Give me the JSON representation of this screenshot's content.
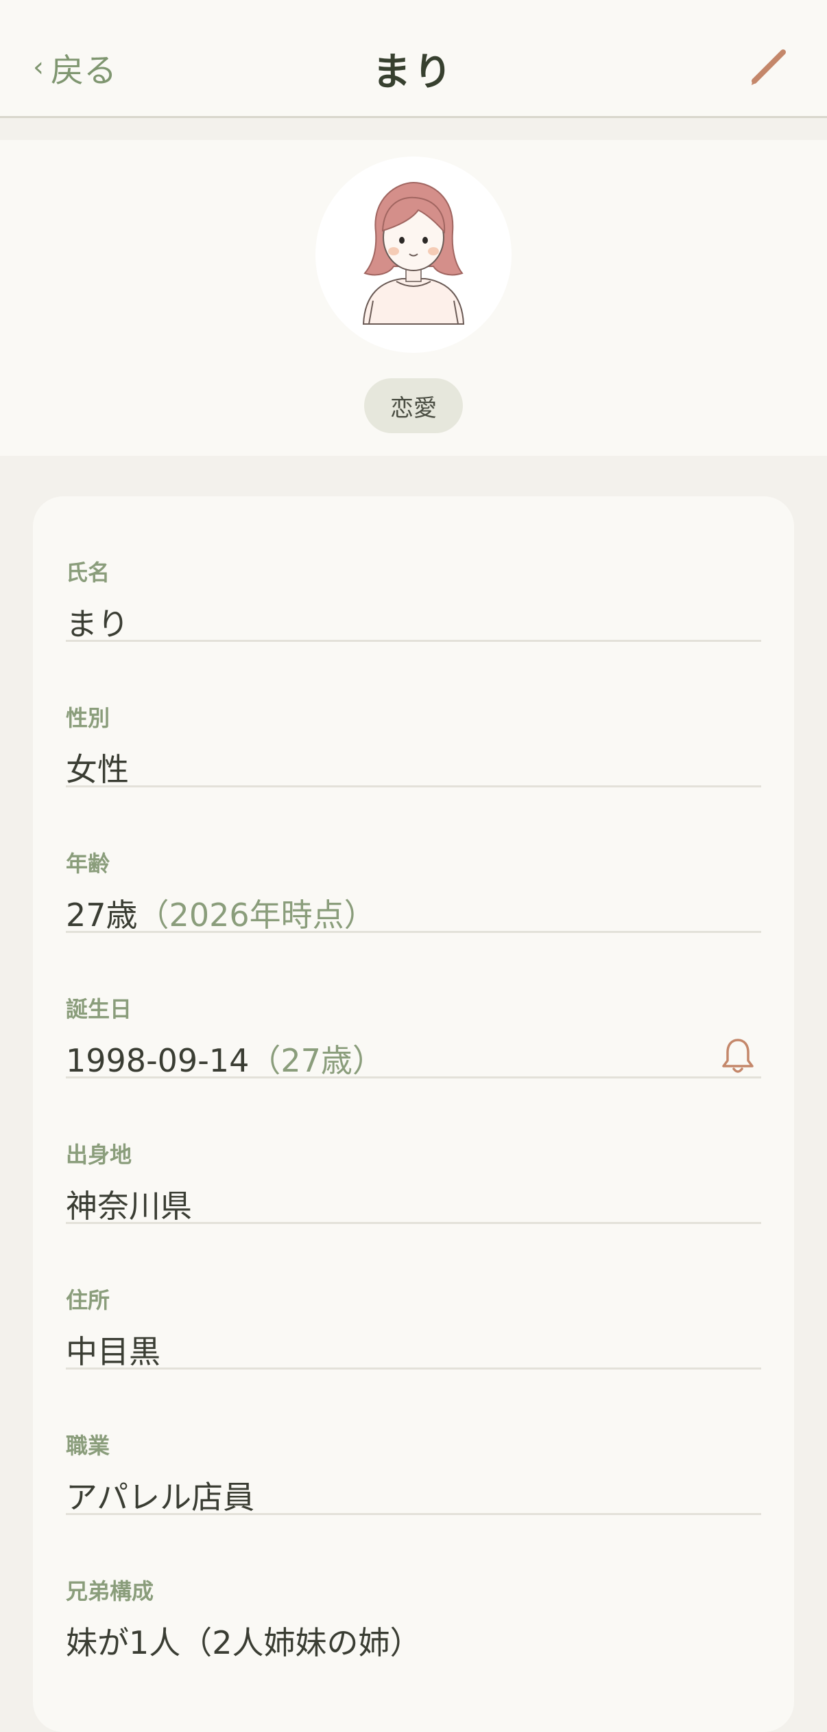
{
  "header": {
    "back_chevron": "‹",
    "back_label": "戻る",
    "title": "まり",
    "edit_icon": "pencil-icon"
  },
  "profile": {
    "avatar": "woman-illustration",
    "tag": "恋愛"
  },
  "colors": {
    "accent": "#c4876a",
    "label_green": "#8a9d7b",
    "text": "#3a3d33",
    "background": "#f3f1ec",
    "card": "#faf9f5"
  },
  "fields": [
    {
      "label": "氏名",
      "value": "まり"
    },
    {
      "label": "性別",
      "value": "女性"
    },
    {
      "label": "年齢",
      "value": "27歳",
      "sub": "（2026年時点）"
    },
    {
      "label": "誕生日",
      "value": "1998-09-14",
      "sub": "（27歳）",
      "icon": "bell-icon"
    },
    {
      "label": "出身地",
      "value": "神奈川県"
    },
    {
      "label": "住所",
      "value": "中目黒"
    },
    {
      "label": "職業",
      "value": "アパレル店員"
    },
    {
      "label": "兄弟構成",
      "value": "妹が1人（2人姉妹の姉）"
    }
  ]
}
